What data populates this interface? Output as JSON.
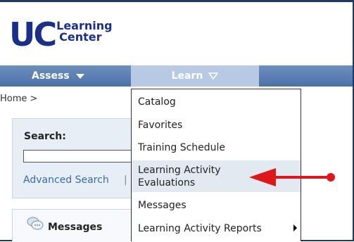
{
  "logo": {
    "uc": "UC",
    "line1": "Learning",
    "line2": "Center"
  },
  "nav": {
    "assess": "Assess",
    "learn": "Learn"
  },
  "breadcrumb": "Home >",
  "search": {
    "label": "Search:",
    "advanced_link": "Advanced Search",
    "separator": "|"
  },
  "messages": {
    "label": "Messages"
  },
  "dropdown": {
    "items": [
      {
        "label": "Catalog"
      },
      {
        "label": "Favorites"
      },
      {
        "label": "Training Schedule"
      },
      {
        "label": "Learning Activity\nEvaluations",
        "highlighted": true
      },
      {
        "label": "Messages"
      },
      {
        "label": "Learning Activity Reports",
        "has_submenu": true
      }
    ]
  },
  "colors": {
    "brand": "#1a2f8a",
    "nav": "#5a7eb3",
    "active_tab": "#b7c9e3",
    "annotation": "#e0171a"
  }
}
